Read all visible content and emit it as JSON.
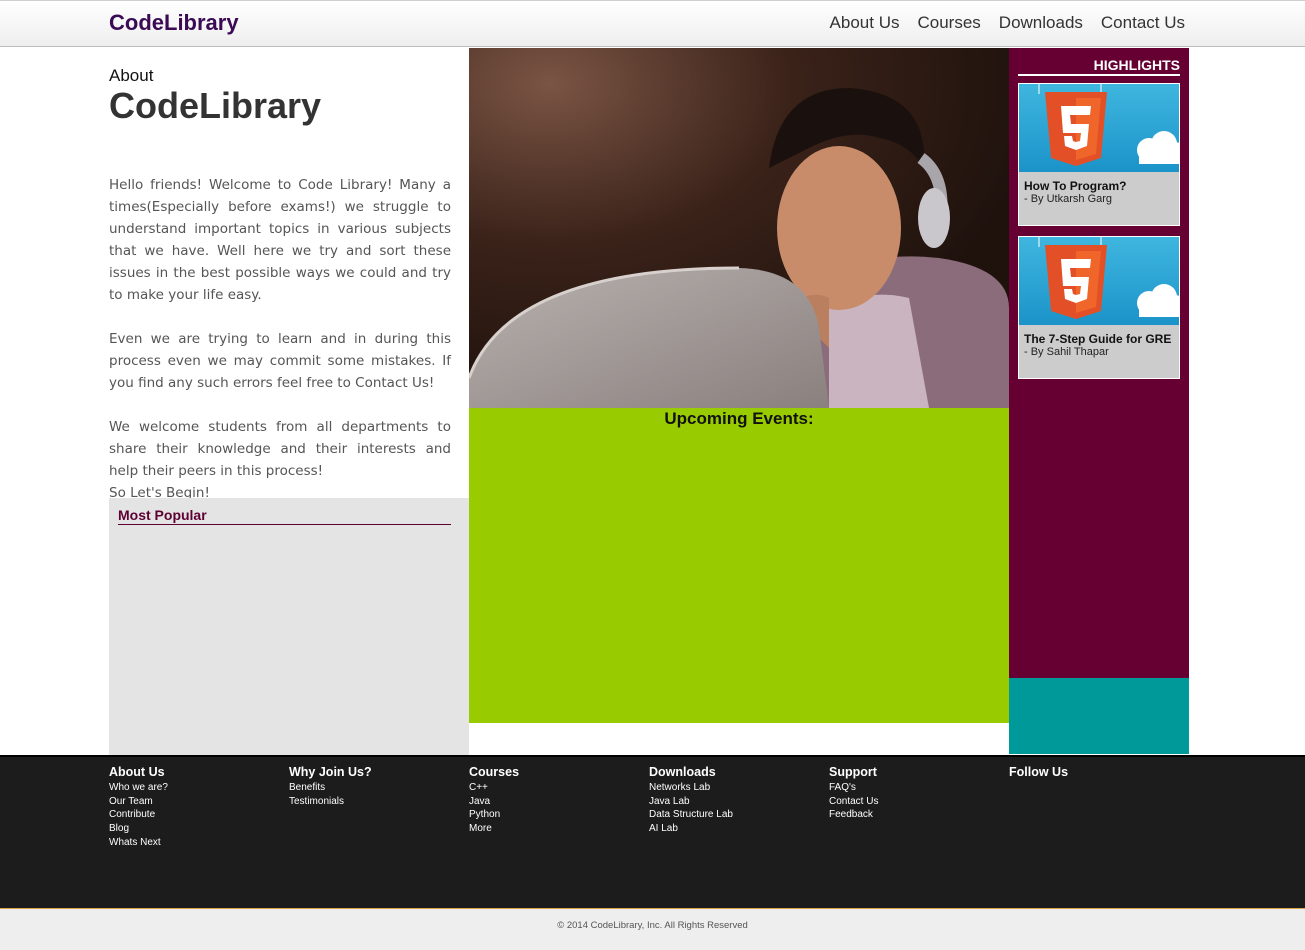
{
  "header": {
    "brand": "CodeLibrary",
    "nav": [
      "About Us",
      "Courses",
      "Downloads",
      "Contact Us"
    ]
  },
  "about": {
    "pre": "About",
    "title": "CodeLibrary",
    "paragraphs": [
      "Hello friends! Welcome to Code Library! Many a times(Especially before exams!) we struggle to understand important topics in various subjects that we have. Well here we try and sort these issues in the best possible ways we could and try to make your life easy.",
      "Even we are trying to learn and in during this process even we may commit some mistakes. If you find any such errors feel free to Contact Us!",
      "We welcome students from all departments to share their knowledge and their interests and help their peers in this process!",
      "So Let's Begin!"
    ]
  },
  "popular": {
    "title": "Most Popular"
  },
  "events": {
    "title": "Upcoming Events:"
  },
  "highlights": {
    "title": "HIGHLIGHTS",
    "cards": [
      {
        "title": "How To Program?",
        "by": "- By Utkarsh Garg",
        "icon": "html5-icon"
      },
      {
        "title": "The 7-Step Guide for GRE",
        "by": "- By Sahil Thapar",
        "icon": "html5-icon"
      }
    ]
  },
  "footer": {
    "columns": [
      {
        "heading": "About Us",
        "links": [
          "Who we are?",
          "Our Team",
          "Contribute",
          "Blog",
          "Whats Next"
        ]
      },
      {
        "heading": "Why Join Us?",
        "links": [
          "Benefits",
          "Testimonials"
        ]
      },
      {
        "heading": "Courses",
        "links": [
          "C++",
          "Java",
          "Python",
          "More"
        ]
      },
      {
        "heading": "Downloads",
        "links": [
          "Networks Lab",
          "Java Lab",
          "Data Structure Lab",
          "AI Lab"
        ]
      },
      {
        "heading": "Support",
        "links": [
          "FAQ's",
          "Contact Us",
          "Feedback"
        ]
      },
      {
        "heading": "Follow Us",
        "links": []
      }
    ],
    "copyright": "© 2014 CodeLibrary, Inc. All Rights Reserved"
  },
  "colors": {
    "brand": "#3a0a55",
    "highlights_bg": "#660033",
    "events_bg": "#99cc00",
    "teal": "#009999",
    "footer_bg": "#1c1c1c"
  }
}
